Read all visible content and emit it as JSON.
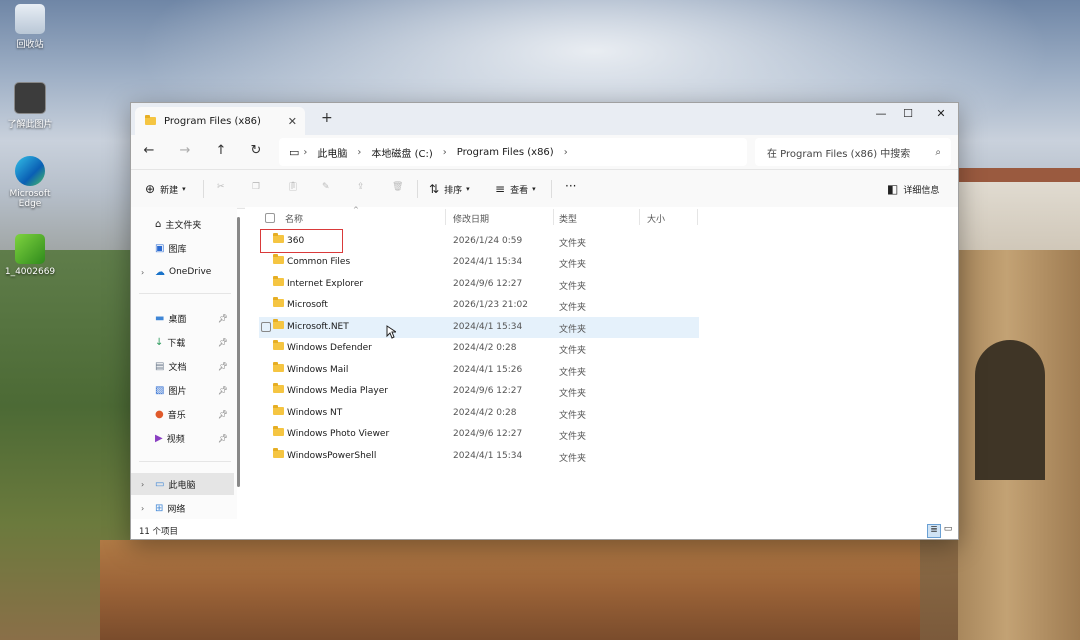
{
  "desktop": {
    "icons": [
      {
        "label": "回收站"
      },
      {
        "label": "了解此图片"
      },
      {
        "label": "Microsoft Edge"
      },
      {
        "label": "1_4002669"
      }
    ]
  },
  "window": {
    "tab_title": "Program Files (x86)",
    "new_tab": "+",
    "controls": {
      "minimize": "—",
      "maximize": "☐",
      "close": "✕"
    }
  },
  "address": {
    "segments": [
      "此电脑",
      "本地磁盘 (C:)",
      "Program Files (x86)"
    ],
    "search_placeholder": "在 Program Files (x86) 中搜索"
  },
  "toolbar": {
    "new": "新建",
    "sort": "排序",
    "view": "查看",
    "more": "···",
    "details": "详细信息"
  },
  "sidebar": {
    "quick": [
      {
        "label": "主文件夹",
        "icon": "home-icon"
      },
      {
        "label": "图库",
        "icon": "gallery-icon"
      },
      {
        "label": "OneDrive",
        "icon": "cloud-icon"
      }
    ],
    "pinned": [
      {
        "label": "桌面",
        "icon": "desktop-icon"
      },
      {
        "label": "下载",
        "icon": "download-icon"
      },
      {
        "label": "文档",
        "icon": "document-icon"
      },
      {
        "label": "图片",
        "icon": "picture-icon"
      },
      {
        "label": "音乐",
        "icon": "music-icon"
      },
      {
        "label": "视频",
        "icon": "video-icon"
      }
    ],
    "devices": [
      {
        "label": "此电脑",
        "icon": "computer-icon"
      },
      {
        "label": "网络",
        "icon": "network-icon"
      }
    ]
  },
  "columns": {
    "name": "名称",
    "date": "修改日期",
    "type": "类型",
    "size": "大小"
  },
  "files": [
    {
      "name": "360",
      "date": "2026/1/24 0:59",
      "type": "文件夹"
    },
    {
      "name": "Common Files",
      "date": "2024/4/1 15:34",
      "type": "文件夹"
    },
    {
      "name": "Internet Explorer",
      "date": "2024/9/6 12:27",
      "type": "文件夹"
    },
    {
      "name": "Microsoft",
      "date": "2026/1/23 21:02",
      "type": "文件夹"
    },
    {
      "name": "Microsoft.NET",
      "date": "2024/4/1 15:34",
      "type": "文件夹"
    },
    {
      "name": "Windows Defender",
      "date": "2024/4/2 0:28",
      "type": "文件夹"
    },
    {
      "name": "Windows Mail",
      "date": "2024/4/1 15:26",
      "type": "文件夹"
    },
    {
      "name": "Windows Media Player",
      "date": "2024/9/6 12:27",
      "type": "文件夹"
    },
    {
      "name": "Windows NT",
      "date": "2024/4/2 0:28",
      "type": "文件夹"
    },
    {
      "name": "Windows Photo Viewer",
      "date": "2024/9/6 12:27",
      "type": "文件夹"
    },
    {
      "name": "WindowsPowerShell",
      "date": "2024/4/1 15:34",
      "type": "文件夹"
    }
  ],
  "status": {
    "count": "11 个项目"
  },
  "colors": {
    "accent": "#0067c0",
    "highlight": "#d93a3a",
    "folder": "#f5c542"
  }
}
